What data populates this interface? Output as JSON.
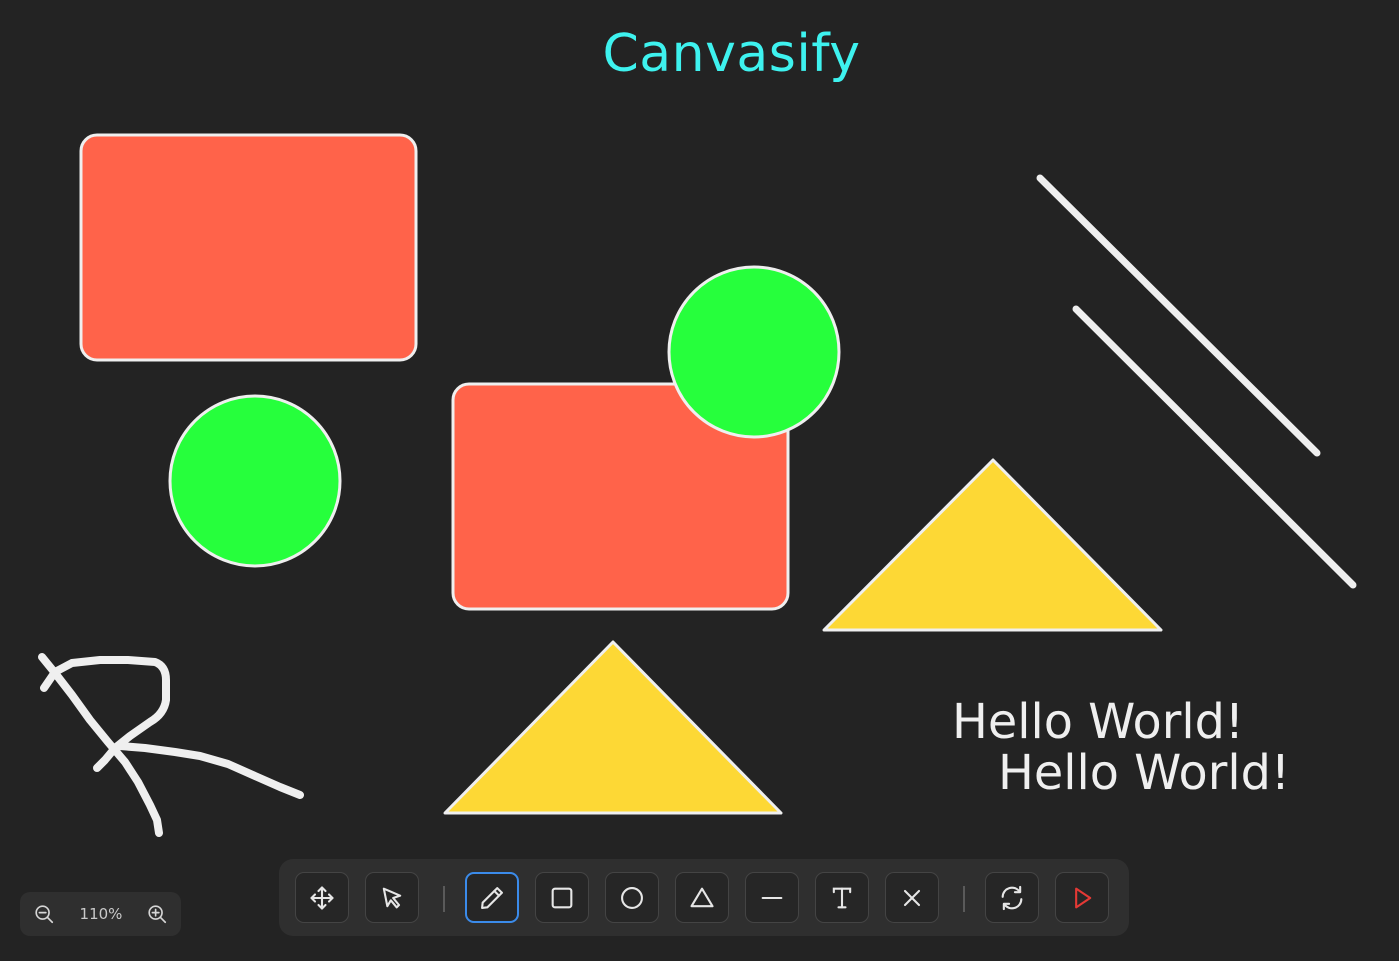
{
  "app": {
    "title": "Canvasify"
  },
  "colors": {
    "background": "#232323",
    "title": "#3ef2ef",
    "rect_fill": "#ff634a",
    "circle_fill": "#26ff3c",
    "triangle_fill": "#fdd835",
    "stroke": "#efefef",
    "accent": "#3b8bea",
    "run": "#e53935"
  },
  "canvas": {
    "texts": [
      "Hello World!",
      "Hello World!"
    ]
  },
  "toolbar": {
    "tools": [
      {
        "name": "move-tool",
        "icon": "move-icon"
      },
      {
        "name": "select-tool",
        "icon": "pointer-icon"
      },
      {
        "name": "pencil-tool",
        "icon": "pencil-icon",
        "active": true
      },
      {
        "name": "rectangle-tool",
        "icon": "square-icon"
      },
      {
        "name": "circle-tool",
        "icon": "circle-icon"
      },
      {
        "name": "triangle-tool",
        "icon": "triangle-icon"
      },
      {
        "name": "line-tool",
        "icon": "minus-icon"
      },
      {
        "name": "text-tool",
        "icon": "text-icon"
      },
      {
        "name": "clear-tool",
        "icon": "close-icon"
      },
      {
        "name": "refresh-button",
        "icon": "refresh-icon"
      },
      {
        "name": "play-button",
        "icon": "play-icon"
      }
    ]
  },
  "zoom": {
    "level": "110%"
  }
}
